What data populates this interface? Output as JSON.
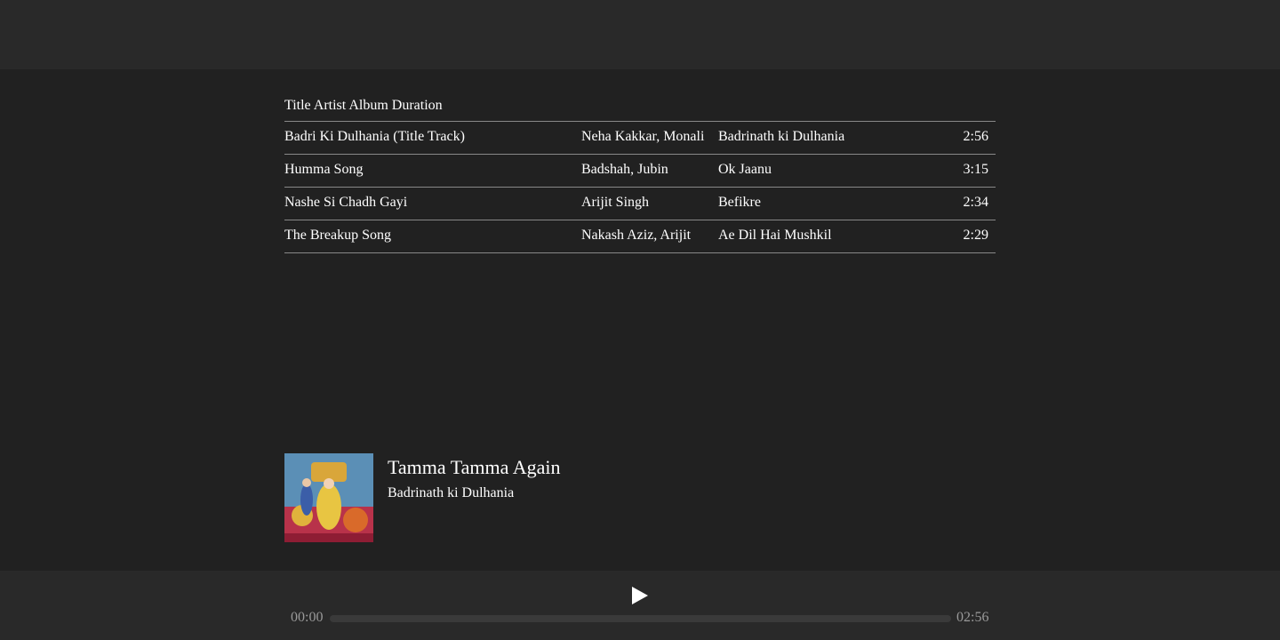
{
  "table": {
    "headers": [
      "Title",
      "Artist",
      "Album",
      "Duration"
    ],
    "rows": [
      {
        "title": "Badri Ki Dulhania (Title Track)",
        "artist": "Neha Kakkar, Monali",
        "album": "Badrinath ki Dulhania",
        "duration": "2:56"
      },
      {
        "title": "Humma Song",
        "artist": "Badshah, Jubin",
        "album": "Ok Jaanu",
        "duration": "3:15"
      },
      {
        "title": "Nashe Si Chadh Gayi",
        "artist": "Arijit Singh",
        "album": "Befikre",
        "duration": "2:34"
      },
      {
        "title": "The Breakup Song",
        "artist": "Nakash Aziz, Arijit",
        "album": "Ae Dil Hai Mushkil",
        "duration": "2:29"
      }
    ]
  },
  "now_playing": {
    "title": "Tamma Tamma Again",
    "album": "Badrinath ki Dulhania"
  },
  "player": {
    "play_icon": "play-icon",
    "current_time": "00:00",
    "total_time": "02:56",
    "progress_fraction": 0
  },
  "colors": {
    "background": "#212121",
    "bars": "#292929",
    "divider": "#888888",
    "muted_text": "#9a9a9a"
  }
}
